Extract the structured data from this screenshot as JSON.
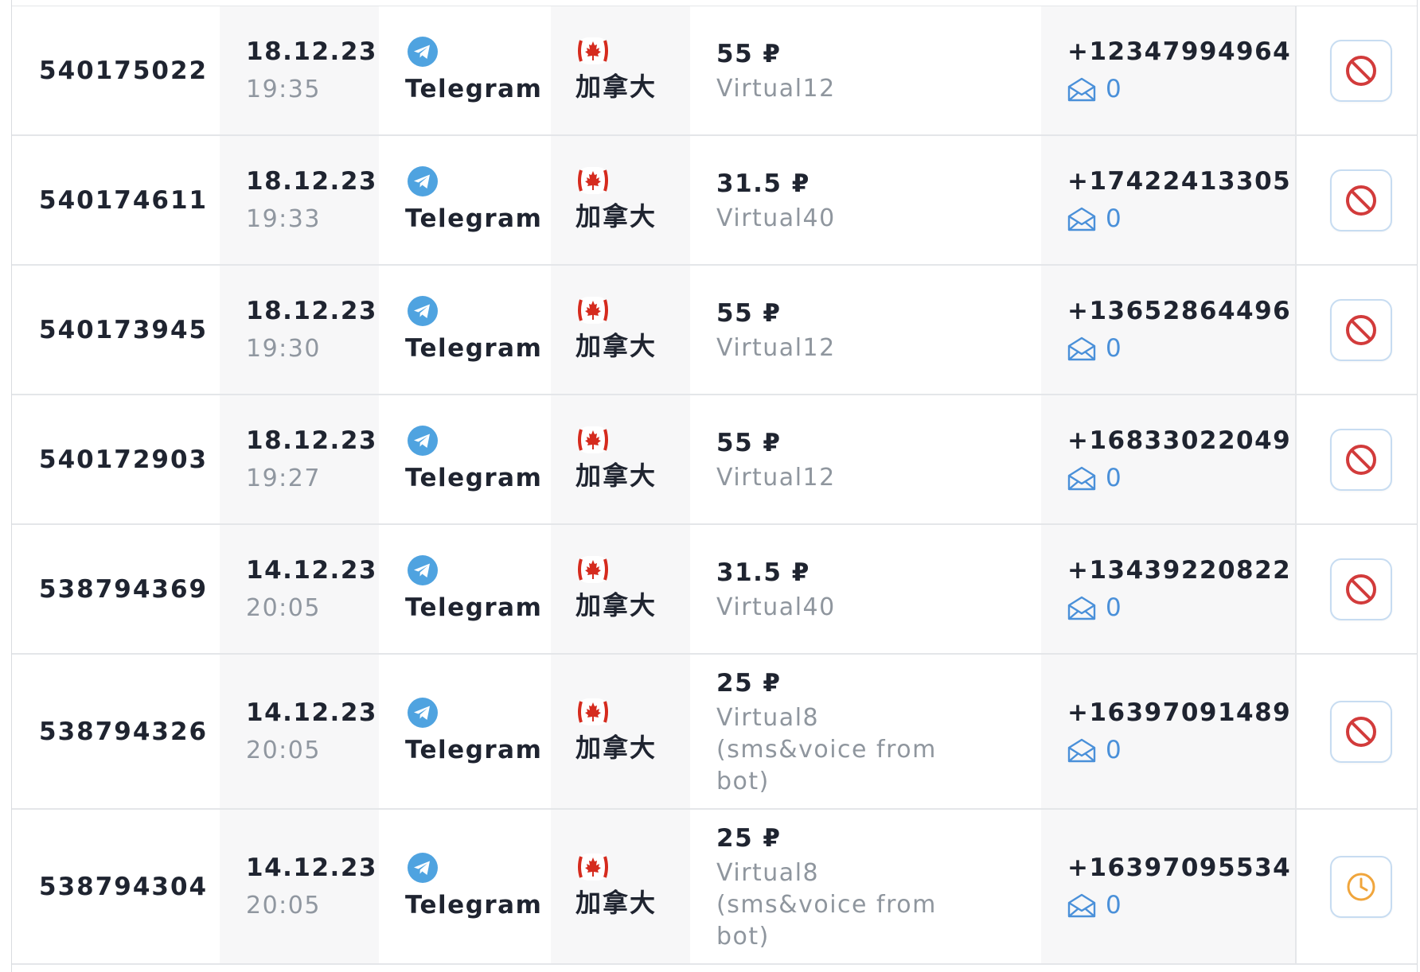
{
  "colors": {
    "cancel_icon": "#d23b3b",
    "pending_icon": "#f0a53c",
    "sms_link": "#4a90d9",
    "telegram": "#4fa3e0"
  },
  "rows": [
    {
      "id": "540175022",
      "date": "18.12.23",
      "time": "19:35",
      "service": "Telegram",
      "service_icon": "telegram-icon",
      "country": "加拿大",
      "flag": "canada-flag",
      "price": "55 ₽",
      "operator": "Virtual12",
      "phone": "+12347994964",
      "sms_count": "0",
      "action": "cancel"
    },
    {
      "id": "540174611",
      "date": "18.12.23",
      "time": "19:33",
      "service": "Telegram",
      "service_icon": "telegram-icon",
      "country": "加拿大",
      "flag": "canada-flag",
      "price": "31.5 ₽",
      "operator": "Virtual40",
      "phone": "+17422413305",
      "sms_count": "0",
      "action": "cancel"
    },
    {
      "id": "540173945",
      "date": "18.12.23",
      "time": "19:30",
      "service": "Telegram",
      "service_icon": "telegram-icon",
      "country": "加拿大",
      "flag": "canada-flag",
      "price": "55 ₽",
      "operator": "Virtual12",
      "phone": "+13652864496",
      "sms_count": "0",
      "action": "cancel"
    },
    {
      "id": "540172903",
      "date": "18.12.23",
      "time": "19:27",
      "service": "Telegram",
      "service_icon": "telegram-icon",
      "country": "加拿大",
      "flag": "canada-flag",
      "price": "55 ₽",
      "operator": "Virtual12",
      "phone": "+16833022049",
      "sms_count": "0",
      "action": "cancel"
    },
    {
      "id": "538794369",
      "date": "14.12.23",
      "time": "20:05",
      "service": "Telegram",
      "service_icon": "telegram-icon",
      "country": "加拿大",
      "flag": "canada-flag",
      "price": "31.5 ₽",
      "operator": "Virtual40",
      "phone": "+13439220822",
      "sms_count": "0",
      "action": "cancel"
    },
    {
      "id": "538794326",
      "date": "14.12.23",
      "time": "20:05",
      "service": "Telegram",
      "service_icon": "telegram-icon",
      "country": "加拿大",
      "flag": "canada-flag",
      "price": "25 ₽",
      "operator": "Virtual8 (sms&voice from bot)",
      "phone": "+16397091489",
      "sms_count": "0",
      "action": "cancel"
    },
    {
      "id": "538794304",
      "date": "14.12.23",
      "time": "20:05",
      "service": "Telegram",
      "service_icon": "telegram-icon",
      "country": "加拿大",
      "flag": "canada-flag",
      "price": "25 ₽",
      "operator": "Virtual8 (sms&voice from bot)",
      "phone": "+16397095534",
      "sms_count": "0",
      "action": "pending"
    }
  ]
}
